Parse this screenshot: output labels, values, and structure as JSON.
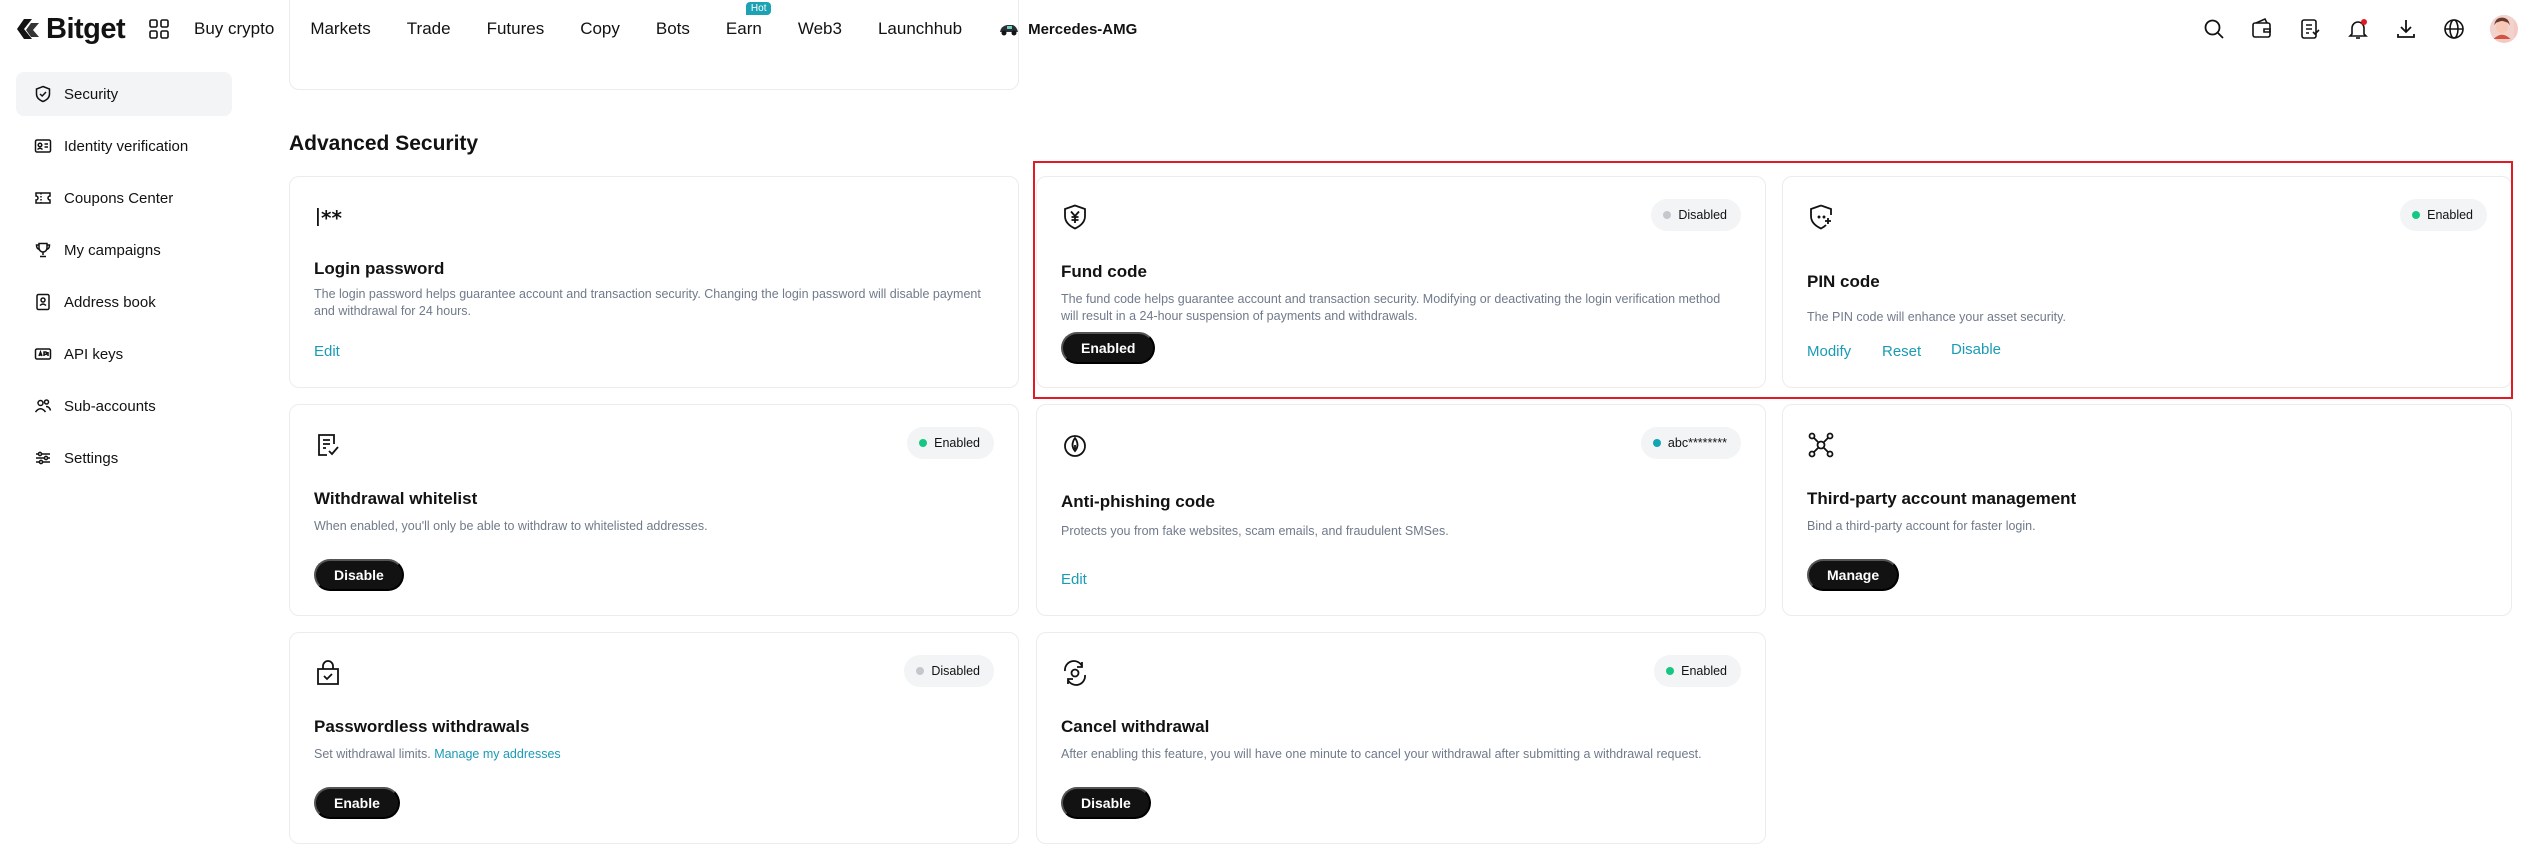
{
  "brand": {
    "name": "Bitget"
  },
  "nav": {
    "items": [
      "Buy crypto",
      "Markets",
      "Trade",
      "Futures",
      "Copy",
      "Bots",
      "Earn",
      "Web3",
      "Launchhub"
    ],
    "hot_badge": "Hot",
    "partner": "Mercedes-AMG"
  },
  "sidebar": {
    "items": [
      {
        "label": "Security",
        "icon": "shield-icon",
        "active": true
      },
      {
        "label": "Identity verification",
        "icon": "id-card-icon"
      },
      {
        "label": "Coupons Center",
        "icon": "coupon-icon"
      },
      {
        "label": "My campaigns",
        "icon": "trophy-icon"
      },
      {
        "label": "Address book",
        "icon": "address-book-icon"
      },
      {
        "label": "API keys",
        "icon": "api-key-icon"
      },
      {
        "label": "Sub-accounts",
        "icon": "users-icon"
      },
      {
        "label": "Settings",
        "icon": "sliders-icon"
      }
    ]
  },
  "section": {
    "title": "Advanced Security"
  },
  "cards": {
    "login_password": {
      "title": "Login password",
      "desc": "The login password helps guarantee account and transaction security. Changing the login password will disable payment and withdrawal for 24 hours.",
      "link": "Edit"
    },
    "fund_code": {
      "title": "Fund code",
      "desc": "The fund code helps guarantee account and transaction security. Modifying or deactivating the login verification method will result in a 24-hour suspension of payments and withdrawals.",
      "status": "Disabled",
      "button": "Enabled"
    },
    "pin_code": {
      "title": "PIN code",
      "desc": "The PIN code will enhance your asset security.",
      "status": "Enabled",
      "links": [
        "Modify",
        "Reset",
        "Disable"
      ]
    },
    "withdrawal_whitelist": {
      "title": "Withdrawal whitelist",
      "desc": "When enabled, you'll only be able to withdraw to whitelisted addresses.",
      "status": "Enabled",
      "button": "Disable"
    },
    "anti_phishing": {
      "title": "Anti-phishing code",
      "desc": "Protects you from fake websites, scam emails, and fraudulent SMSes.",
      "status": "abc********",
      "link": "Edit"
    },
    "third_party": {
      "title": "Third-party account management",
      "desc": "Bind a third-party account for faster login.",
      "button": "Manage"
    },
    "passwordless": {
      "title": "Passwordless withdrawals",
      "desc": "Set withdrawal limits.",
      "desc_link": "Manage my addresses",
      "status": "Disabled",
      "button": "Enable"
    },
    "cancel_withdrawal": {
      "title": "Cancel withdrawal",
      "desc": "After enabling this feature, you will have one minute to cancel your withdrawal after submitting a withdrawal request.",
      "status": "Enabled",
      "button": "Disable"
    }
  },
  "colors": {
    "accent": "#1a9bb5",
    "enabled": "#16c784",
    "disabled": "#c4c7cc",
    "highlight": "#e01b24"
  }
}
